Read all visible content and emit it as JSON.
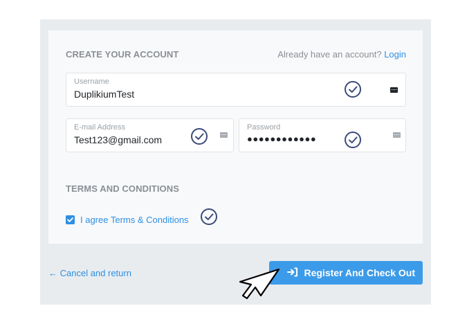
{
  "form": {
    "create_title": "CREATE YOUR ACCOUNT",
    "already_text": "Already have an account?",
    "login_link": "Login",
    "fields": {
      "username": {
        "label": "Username",
        "value": "DuplikiumTest"
      },
      "email": {
        "label": "E-mail Address",
        "value": "Test123@gmail.com"
      },
      "password": {
        "label": "Password",
        "value": "●●●●●●●●●●●●"
      }
    },
    "terms_title": "TERMS AND CONDITIONS",
    "terms_checkbox_label": "I agree Terms & Conditions",
    "terms_checked": true
  },
  "footer": {
    "cancel_label": "← Cancel and return",
    "submit_label": "Register And Check Out"
  },
  "colors": {
    "accent": "#2d8fe4",
    "button": "#3c9be9",
    "validation_ring": "#3a4a7a"
  },
  "icons": [
    "check-circle-icon",
    "password-manager-key-icon",
    "sign-in-icon",
    "mouse-pointer-icon"
  ]
}
